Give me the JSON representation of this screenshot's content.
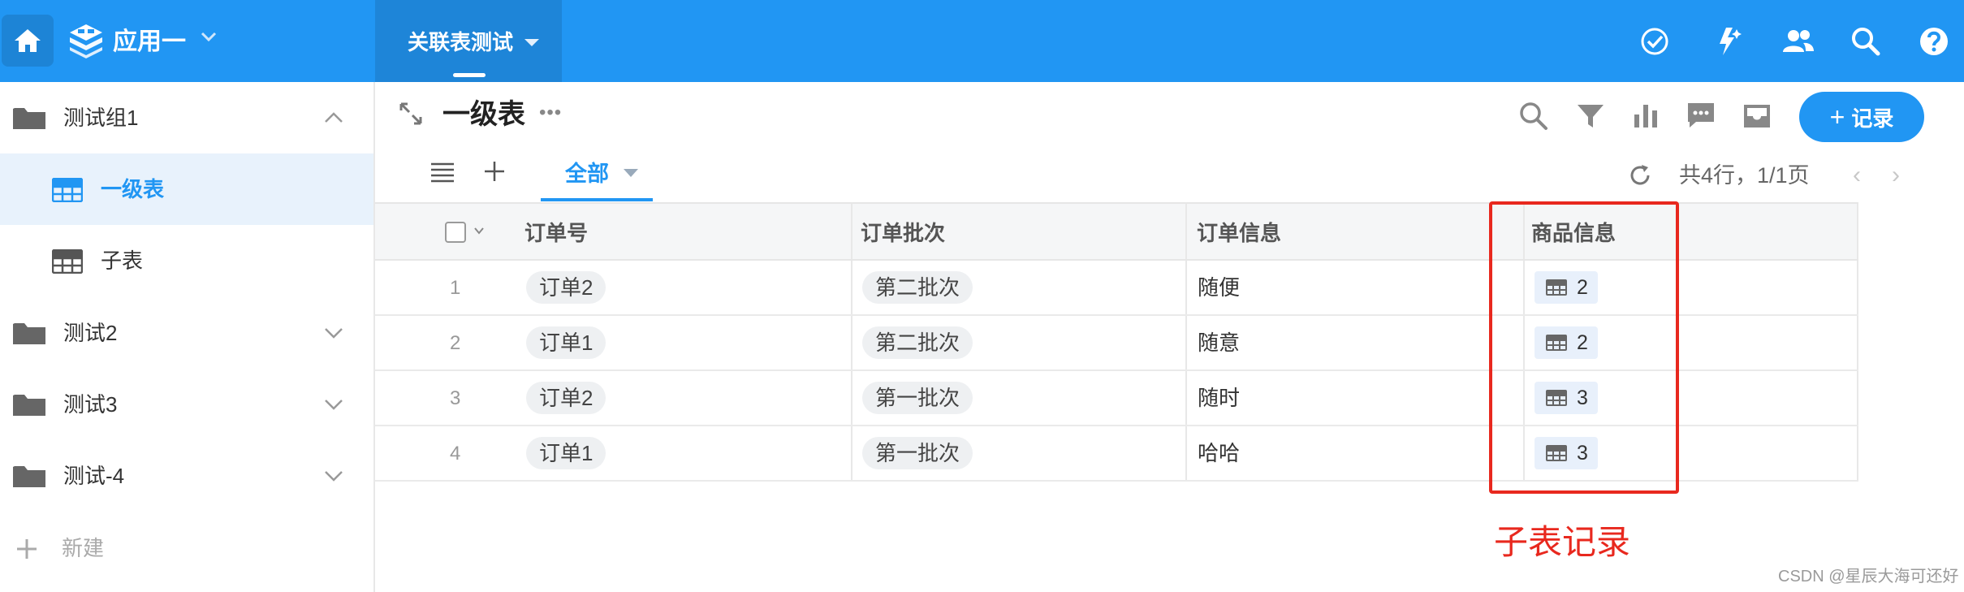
{
  "app": {
    "name": "应用一"
  },
  "topbar": {
    "tab_label": "关联表测试"
  },
  "sidebar": {
    "groups": [
      {
        "label": "测试组1"
      },
      {
        "label": "测试2"
      },
      {
        "label": "测试3"
      },
      {
        "label": "测试-4"
      }
    ],
    "tables": [
      {
        "label": "一级表"
      },
      {
        "label": "子表"
      }
    ],
    "new_label": "新建"
  },
  "main": {
    "title": "一级表",
    "more": "•••",
    "add_record": {
      "plus": "+",
      "label": "记录"
    },
    "view_tab": "全部",
    "page_info": "共4行，1/1页",
    "prev": "‹",
    "next": "›"
  },
  "table": {
    "headers": [
      "订单号",
      "订单批次",
      "订单信息",
      "商品信息"
    ],
    "rows": [
      {
        "num": "1",
        "order": "订单2",
        "batch": "第二批次",
        "info": "随便",
        "goods": "2"
      },
      {
        "num": "2",
        "order": "订单1",
        "batch": "第二批次",
        "info": "随意",
        "goods": "2"
      },
      {
        "num": "3",
        "order": "订单2",
        "batch": "第一批次",
        "info": "随时",
        "goods": "3"
      },
      {
        "num": "4",
        "order": "订单1",
        "batch": "第一批次",
        "info": "哈哈",
        "goods": "3"
      }
    ]
  },
  "annotation": {
    "text": "子表记录"
  },
  "watermark": "CSDN @星辰大海可还好",
  "colors": {
    "primary": "#2196f3",
    "annotation": "#e8281e"
  }
}
